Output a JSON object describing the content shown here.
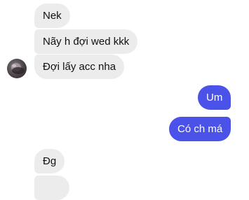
{
  "conversation": {
    "messages": [
      {
        "from": "them",
        "text": "Nek"
      },
      {
        "from": "them",
        "text": "Nãy h đợi wed kkk"
      },
      {
        "from": "them",
        "text": "Đợi lấy acc nha"
      },
      {
        "from": "me",
        "text": "Um"
      },
      {
        "from": "me",
        "text": "Có ch má"
      },
      {
        "from": "them",
        "text": "Đg"
      },
      {
        "from": "them",
        "text": ""
      }
    ]
  },
  "colors": {
    "incoming_bubble": "#ececec",
    "outgoing_bubble": "#4a52e8",
    "incoming_text": "#111111",
    "outgoing_text": "#ffffff"
  },
  "icons": {
    "avatar": "contact-avatar"
  }
}
